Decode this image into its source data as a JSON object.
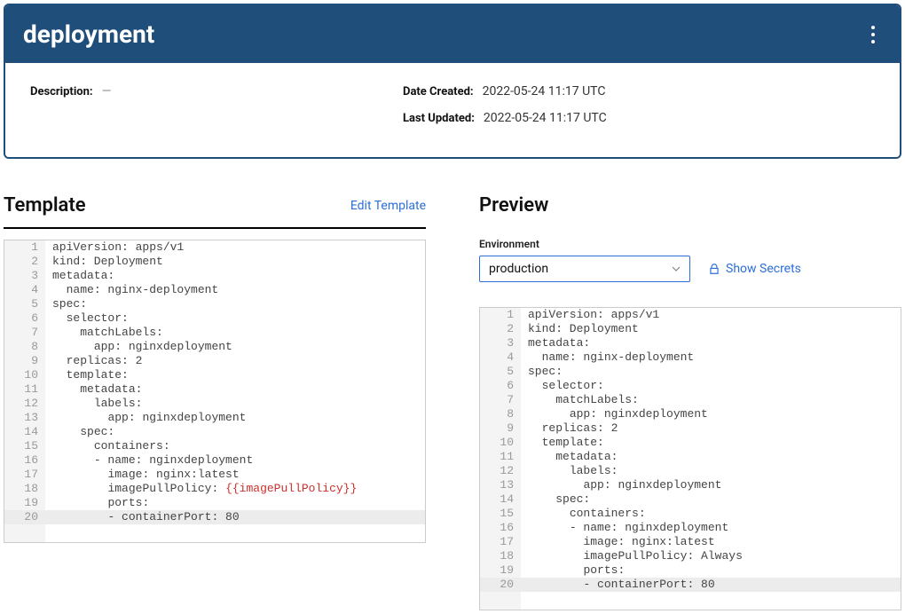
{
  "header": {
    "title": "deployment"
  },
  "meta": {
    "description_label": "Description:",
    "description_value": "—",
    "date_created_label": "Date Created:",
    "date_created_value": "2022-05-24 11:17 UTC",
    "last_updated_label": "Last Updated:",
    "last_updated_value": "2022-05-24 11:17 UTC"
  },
  "template": {
    "heading": "Template",
    "edit_label": "Edit Template",
    "lines": [
      {
        "n": "1",
        "text": "apiVersion: apps/v1"
      },
      {
        "n": "2",
        "text": "kind: Deployment"
      },
      {
        "n": "3",
        "text": "metadata:"
      },
      {
        "n": "4",
        "text": "  name: nginx-deployment"
      },
      {
        "n": "5",
        "text": "spec:"
      },
      {
        "n": "6",
        "text": "  selector:"
      },
      {
        "n": "7",
        "text": "    matchLabels:"
      },
      {
        "n": "8",
        "text": "      app: nginxdeployment"
      },
      {
        "n": "9",
        "text": "  replicas: 2"
      },
      {
        "n": "10",
        "text": "  template:"
      },
      {
        "n": "11",
        "text": "    metadata:"
      },
      {
        "n": "12",
        "text": "      labels:"
      },
      {
        "n": "13",
        "text": "        app: nginxdeployment"
      },
      {
        "n": "14",
        "text": "    spec:"
      },
      {
        "n": "15",
        "text": "      containers:"
      },
      {
        "n": "16",
        "text": "      - name: nginxdeployment"
      },
      {
        "n": "17",
        "text": "        image: nginx:latest"
      },
      {
        "n": "18",
        "text": "        imagePullPolicy: ",
        "var": "{{imagePullPolicy}}"
      },
      {
        "n": "19",
        "text": "        ports:"
      },
      {
        "n": "20",
        "text": "        - containerPort: 80",
        "hl": true
      }
    ]
  },
  "preview": {
    "heading": "Preview",
    "environment_label": "Environment",
    "environment_selected": "production",
    "show_secrets_label": "Show Secrets",
    "lines": [
      {
        "n": "1",
        "text": "apiVersion: apps/v1"
      },
      {
        "n": "2",
        "text": "kind: Deployment"
      },
      {
        "n": "3",
        "text": "metadata:"
      },
      {
        "n": "4",
        "text": "  name: nginx-deployment"
      },
      {
        "n": "5",
        "text": "spec:"
      },
      {
        "n": "6",
        "text": "  selector:"
      },
      {
        "n": "7",
        "text": "    matchLabels:"
      },
      {
        "n": "8",
        "text": "      app: nginxdeployment"
      },
      {
        "n": "9",
        "text": "  replicas: 2"
      },
      {
        "n": "10",
        "text": "  template:"
      },
      {
        "n": "11",
        "text": "    metadata:"
      },
      {
        "n": "12",
        "text": "      labels:"
      },
      {
        "n": "13",
        "text": "        app: nginxdeployment"
      },
      {
        "n": "14",
        "text": "    spec:"
      },
      {
        "n": "15",
        "text": "      containers:"
      },
      {
        "n": "16",
        "text": "      - name: nginxdeployment"
      },
      {
        "n": "17",
        "text": "        image: nginx:latest"
      },
      {
        "n": "18",
        "text": "        imagePullPolicy: Always"
      },
      {
        "n": "19",
        "text": "        ports:"
      },
      {
        "n": "20",
        "text": "        - containerPort: 80",
        "hl": true
      }
    ]
  }
}
